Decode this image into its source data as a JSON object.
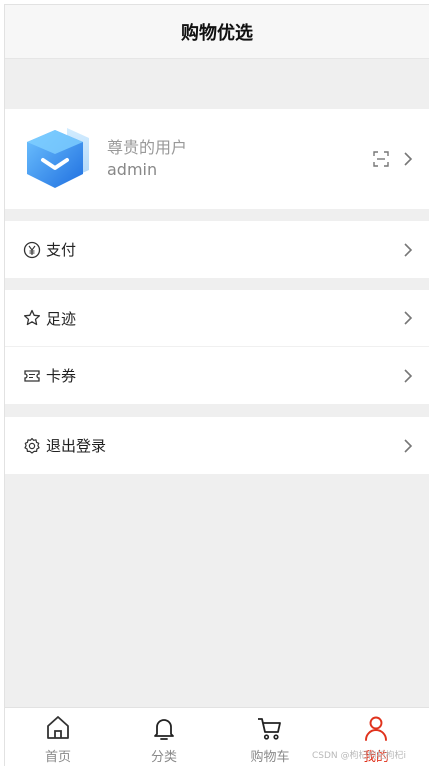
{
  "header": {
    "title": "购物优选"
  },
  "profile": {
    "name": "尊贵的用户",
    "account": "admin",
    "avatar_icon": "blue-cube-icon",
    "scan_icon": "scan-icon"
  },
  "menu": {
    "pay": {
      "label": "支付",
      "icon": "yuan-circle-icon"
    },
    "footprint": {
      "label": "足迹",
      "icon": "star-icon"
    },
    "coupon": {
      "label": "卡券",
      "icon": "ticket-icon"
    },
    "logout": {
      "label": "退出登录",
      "icon": "gear-icon"
    }
  },
  "tabbar": {
    "tabs": [
      {
        "label": "首页",
        "icon": "home-icon"
      },
      {
        "label": "分类",
        "icon": "bell-icon"
      },
      {
        "label": "购物车",
        "icon": "cart-icon"
      },
      {
        "label": "我的",
        "icon": "user-icon"
      }
    ],
    "active_index": 3
  },
  "watermark": "CSDN @枸杞枸杞枸杞i",
  "colors": {
    "accent": "#e0321c",
    "background": "#efefef",
    "avatar_blue": "#2f8ff0"
  }
}
